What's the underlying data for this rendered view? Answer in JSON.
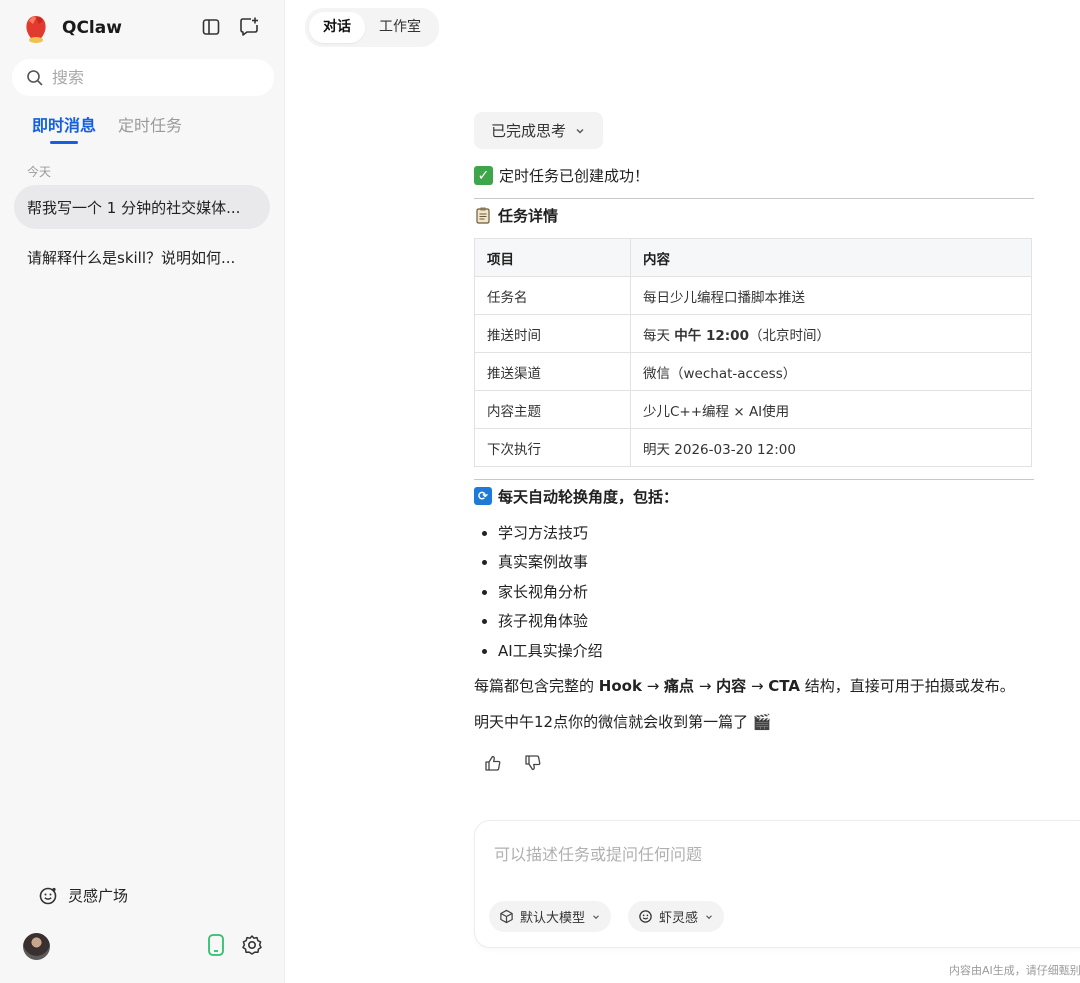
{
  "app": {
    "name": "QClaw"
  },
  "sidebar": {
    "search_placeholder": "搜索",
    "tabs": [
      {
        "label": "即时消息",
        "active": true
      },
      {
        "label": "定时任务",
        "active": false
      }
    ],
    "section_label": "今天",
    "conversations": [
      {
        "title": "帮我写一个 1 分钟的社交媒体...",
        "active": true
      },
      {
        "title": "请解释什么是skill？说明如何...",
        "active": false
      }
    ],
    "inspiration": "灵感广场"
  },
  "main": {
    "tabs": [
      {
        "label": "对话",
        "active": true
      },
      {
        "label": "工作室",
        "active": false
      }
    ],
    "thinking_label": "已完成思考",
    "status": "定时任务已创建成功！",
    "details_heading": "任务详情",
    "table": {
      "headers": [
        "项目",
        "内容"
      ],
      "rows": [
        [
          "任务名",
          "每日少儿编程口播脚本推送"
        ],
        [
          "推送时间",
          "每天 中午 12:00（北京时间）"
        ],
        [
          "推送渠道",
          "微信（wechat-access）"
        ],
        [
          "内容主题",
          "少儿C++编程 × AI使用"
        ],
        [
          "下次执行",
          "明天 2026-03-20 12:00"
        ]
      ]
    },
    "rotation_heading": "每天自动轮换角度，包括：",
    "angles": [
      "学习方法技巧",
      "真实案例故事",
      "家长视角分析",
      "孩子视角体验",
      "AI工具实操介绍"
    ],
    "structure_text": "每篇都包含完整的 Hook → 痛点 → 内容 → CTA 结构，直接可用于拍摄或发布。",
    "closing_text": "明天中午12点你的微信就会收到第一篇了 🎬"
  },
  "composer": {
    "placeholder": "可以描述任务或提问任何问题",
    "model_label": "默认大模型",
    "inspire_label": "虾灵感"
  },
  "footer_note": "内容由AI生成，请仔细甄别",
  "colors": {
    "accent": "#1560e0",
    "sidebar_bg": "#f7f7f8",
    "check_green": "#3ea64a"
  }
}
